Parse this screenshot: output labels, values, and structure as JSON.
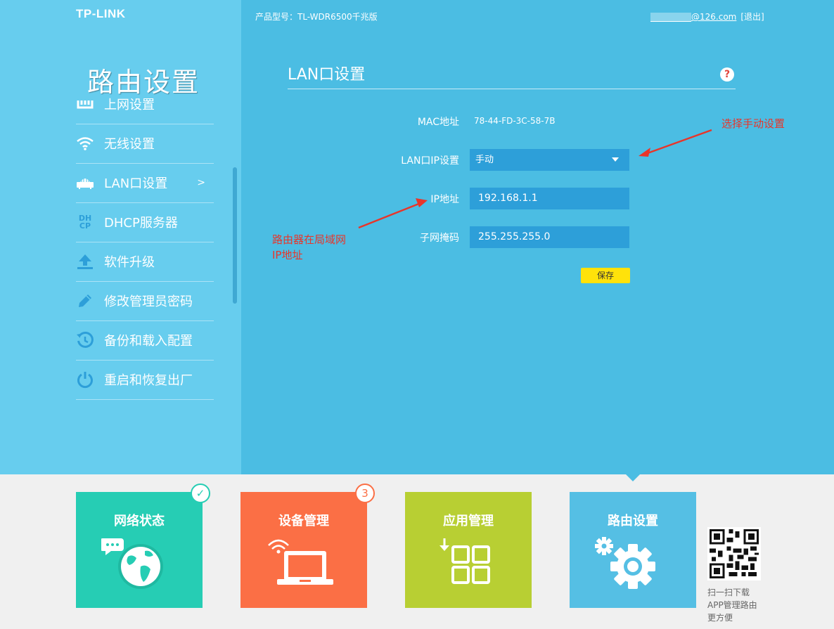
{
  "header": {
    "logo": "TP-LINK",
    "product_model": "产品型号：TL-WDR6500千兆版",
    "account_email_suffix": "@126.com",
    "logout": "[退出]"
  },
  "sidebar": {
    "title": "路由设置",
    "items": [
      {
        "label": "上网设置",
        "icon": "ethernet-icon",
        "clipped": true
      },
      {
        "label": "无线设置",
        "icon": "wifi-icon"
      },
      {
        "label": "LAN口设置",
        "icon": "router-icon",
        "active": true,
        "arrow": ">"
      },
      {
        "label": "DHCP服务器",
        "icon": "dhcp-icon",
        "icon_text": [
          "DH",
          "CP"
        ]
      },
      {
        "label": "软件升级",
        "icon": "upload-icon"
      },
      {
        "label": "修改管理员密码",
        "icon": "pencil-icon"
      },
      {
        "label": "备份和载入配置",
        "icon": "history-icon"
      },
      {
        "label": "重启和恢复出厂",
        "icon": "power-icon"
      }
    ]
  },
  "panel": {
    "title": "LAN口设置",
    "help": "?",
    "mac_label": "MAC地址",
    "mac_value": "78-44-FD-3C-58-7B",
    "lan_ip_label": "LAN口IP设置",
    "lan_ip_mode": "手动",
    "ip_label": "IP地址",
    "ip_value": "192.168.1.1",
    "mask_label": "子网掩码",
    "mask_value": "255.255.255.0",
    "save_label": "保存"
  },
  "annotations": {
    "manual": "选择手动设置",
    "ip_line1": "路由器在局域网",
    "ip_line2": "IP地址"
  },
  "tiles": [
    {
      "label": "网络状态",
      "color": "#26cdb4",
      "badge": "✓",
      "icon": "globe-chat-icon"
    },
    {
      "label": "设备管理",
      "color": "#fb6f45",
      "badge": "3",
      "icon": "laptop-wifi-icon"
    },
    {
      "label": "应用管理",
      "color": "#b8cf33",
      "icon": "apps-grid-icon"
    },
    {
      "label": "路由设置",
      "color": "#55bfe4",
      "icon": "gears-icon",
      "active": true
    }
  ],
  "qr": {
    "line1": "扫一扫下载",
    "line2": "APP管理路由",
    "line3": "更方便"
  },
  "colors": {
    "sidebar": "#67cdee",
    "main": "#4bbde3",
    "field": "#2d9fd9",
    "save": "#ffe20a",
    "annotation": "#e8352a"
  }
}
